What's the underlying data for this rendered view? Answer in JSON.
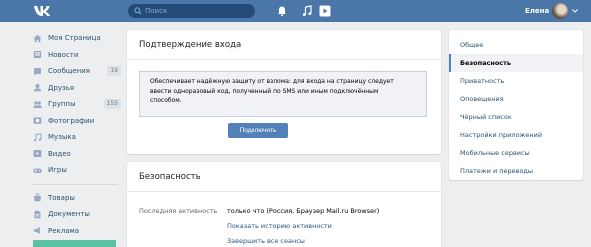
{
  "header": {
    "search_placeholder": "Поиск",
    "user_name": "Елена",
    "bg_color": "#4a76a8"
  },
  "left_nav": {
    "items": [
      {
        "label": "Моя Страница",
        "icon": "home-icon"
      },
      {
        "label": "Новости",
        "icon": "news-icon"
      },
      {
        "label": "Сообщения",
        "icon": "messages-icon",
        "badge": "19"
      },
      {
        "label": "Друзья",
        "icon": "friends-icon"
      },
      {
        "label": "Группы",
        "icon": "groups-icon",
        "badge": "155"
      },
      {
        "label": "Фотографии",
        "icon": "photos-icon"
      },
      {
        "label": "Музыка",
        "icon": "music-icon"
      },
      {
        "label": "Видео",
        "icon": "video-icon"
      },
      {
        "label": "Игры",
        "icon": "games-icon"
      }
    ],
    "items2": [
      {
        "label": "Товары",
        "icon": "goods-icon"
      },
      {
        "label": "Документы",
        "icon": "documents-icon"
      },
      {
        "label": "Реклама",
        "icon": "ads-icon"
      }
    ]
  },
  "login_confirm": {
    "title": "Подтверждение входа",
    "notice_line1": "Обеспечивает надёжную защиту от взлома: для входа на страницу следует",
    "notice_line2": "ввести одноразовый код, полученный по SMS или иным подключённым",
    "notice_line3": "способом.",
    "button": "Подключить"
  },
  "security": {
    "title": "Безопасность",
    "last_activity_label": "Последняя активность",
    "last_activity_value": "только что (Россия, Браузер Mail.ru Browser)",
    "show_history": "Показать историю активности",
    "end_sessions": "Завершить все сеансы"
  },
  "right_nav": {
    "items": [
      "Общее",
      "Безопасность",
      "Приватность",
      "Оповещения",
      "Чёрный список",
      "Настройки приложений",
      "Мобильные сервисы",
      "Платежи и переводы"
    ],
    "active_index": 1
  }
}
